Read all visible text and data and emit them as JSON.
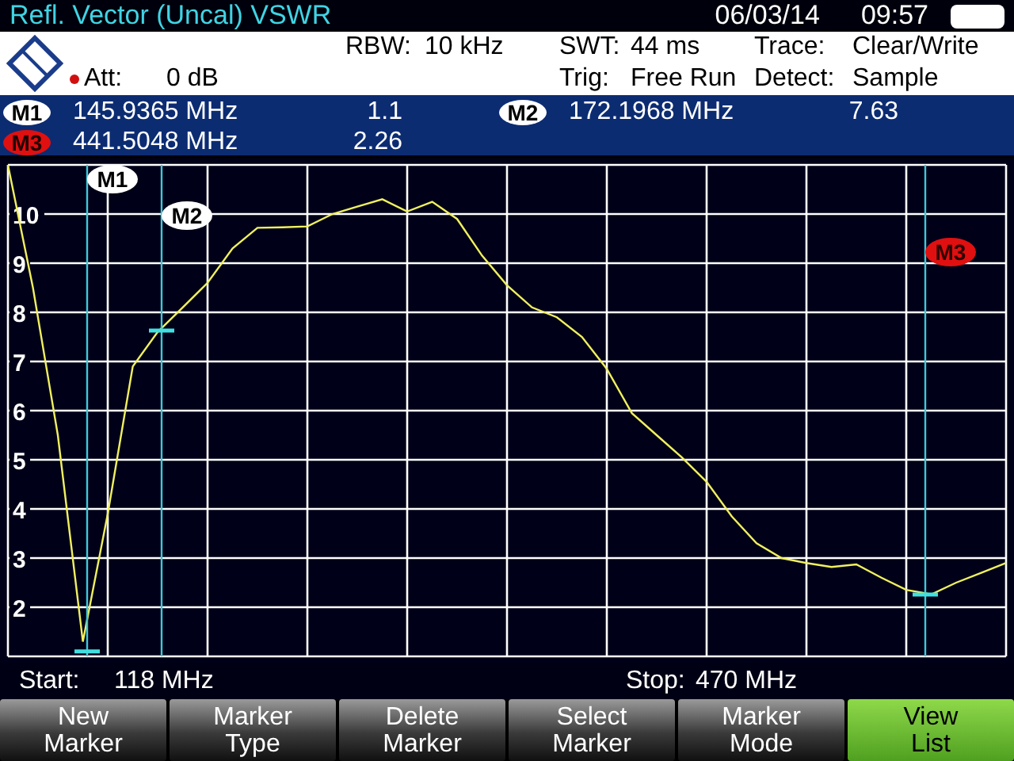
{
  "title_bar": {
    "title": "Refl. Vector (Uncal) VSWR",
    "date": "06/03/14",
    "time": "09:57"
  },
  "settings": [
    {
      "label": "RBW:",
      "value": "10 kHz"
    },
    {
      "label": "SWT:",
      "value": "44 ms"
    },
    {
      "label": "Trace:",
      "value": "Clear/Write"
    },
    {
      "label": "Att:",
      "value": "0 dB"
    },
    {
      "label": "Trig:",
      "value": "Free Run"
    },
    {
      "label": "Detect:",
      "value": "Sample"
    }
  ],
  "markers": [
    {
      "label": "M1",
      "frequency": "145.9365 MHz",
      "value": "1.1",
      "selected": false
    },
    {
      "label": "M2",
      "frequency": "172.1968 MHz",
      "value": "7.63",
      "selected": false
    },
    {
      "label": "M3",
      "frequency": "441.5048 MHz",
      "value": "2.26",
      "selected": true
    }
  ],
  "chart": {
    "marker_labels": [
      {
        "label": "M1",
        "selected": false
      },
      {
        "label": "M2",
        "selected": false
      },
      {
        "label": "M3",
        "selected": true
      }
    ],
    "chart_data": {
      "type": "line",
      "grid": true,
      "ylim": [
        1,
        11
      ],
      "yticks": [
        2,
        3,
        4,
        5,
        6,
        7,
        8,
        9,
        10
      ],
      "categories": [
        null,
        null,
        null,
        null,
        null,
        null,
        null,
        null,
        null,
        null,
        null,
        null,
        null,
        null,
        null,
        null,
        null,
        null,
        null,
        null,
        null,
        null,
        null,
        null,
        null,
        null,
        null,
        null,
        null,
        null,
        null,
        null,
        null,
        null,
        null,
        null,
        null,
        null,
        null,
        null,
        null
      ],
      "series": [
        {
          "color": "#f0f060",
          "values": [
            11,
            8.5,
            5.5,
            1.3,
            3.9,
            6.9,
            7.6,
            8.1,
            8.6,
            9.3,
            9.72,
            9.73,
            9.75,
            10.0,
            10.15,
            10.3,
            10.05,
            10.25,
            9.9,
            9.15,
            8.55,
            8.1,
            7.9,
            7.5,
            6.85,
            5.95,
            5.5,
            5.05,
            4.55,
            3.85,
            3.3,
            3.0,
            2.9,
            2.82,
            2.87,
            2.6,
            2.35,
            2.26,
            2.5,
            2.7,
            2.9
          ]
        }
      ]
    }
  },
  "span": {
    "start_label": "Start:",
    "start": "118 MHz",
    "stop_label": "Stop:",
    "stop": "470 MHz"
  },
  "softkeys": [
    {
      "label": "New\nMarker",
      "selected": false
    },
    {
      "label": "Marker\nType",
      "selected": false
    },
    {
      "label": "Delete\nMarker",
      "selected": false
    },
    {
      "label": "Select\nMarker",
      "selected": false
    },
    {
      "label": "Marker\nMode",
      "selected": false
    },
    {
      "label": "View\nList",
      "selected": true
    }
  ]
}
